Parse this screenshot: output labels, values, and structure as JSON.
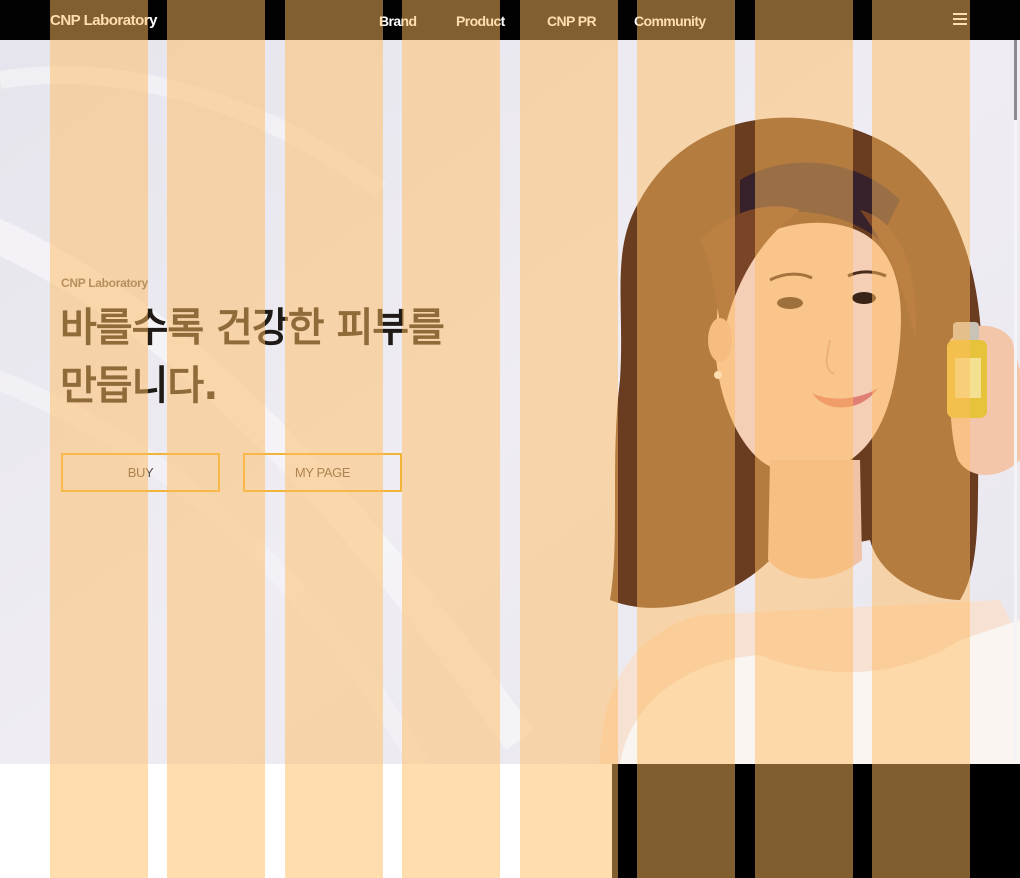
{
  "nav": {
    "brand": "CNP Laboratory",
    "links": [
      {
        "label": "Brand"
      },
      {
        "label": "Product"
      },
      {
        "label": "CNP PR"
      },
      {
        "label": "Community"
      }
    ],
    "menu_icon": "hamburger-menu-icon"
  },
  "hero": {
    "eyebrow": "CNP Laboratory",
    "headline": "바를수록 건강한 피부를\n만듭니다.",
    "buttons": [
      {
        "label": "BUY"
      },
      {
        "label": "MY PAGE"
      }
    ],
    "image": "model-holding-ampoule-photo"
  },
  "colors": {
    "navbar": "#020202",
    "button_border": "#f3b537",
    "stripe_overlay": "#ffbb60",
    "headline": "#1f1a15"
  }
}
